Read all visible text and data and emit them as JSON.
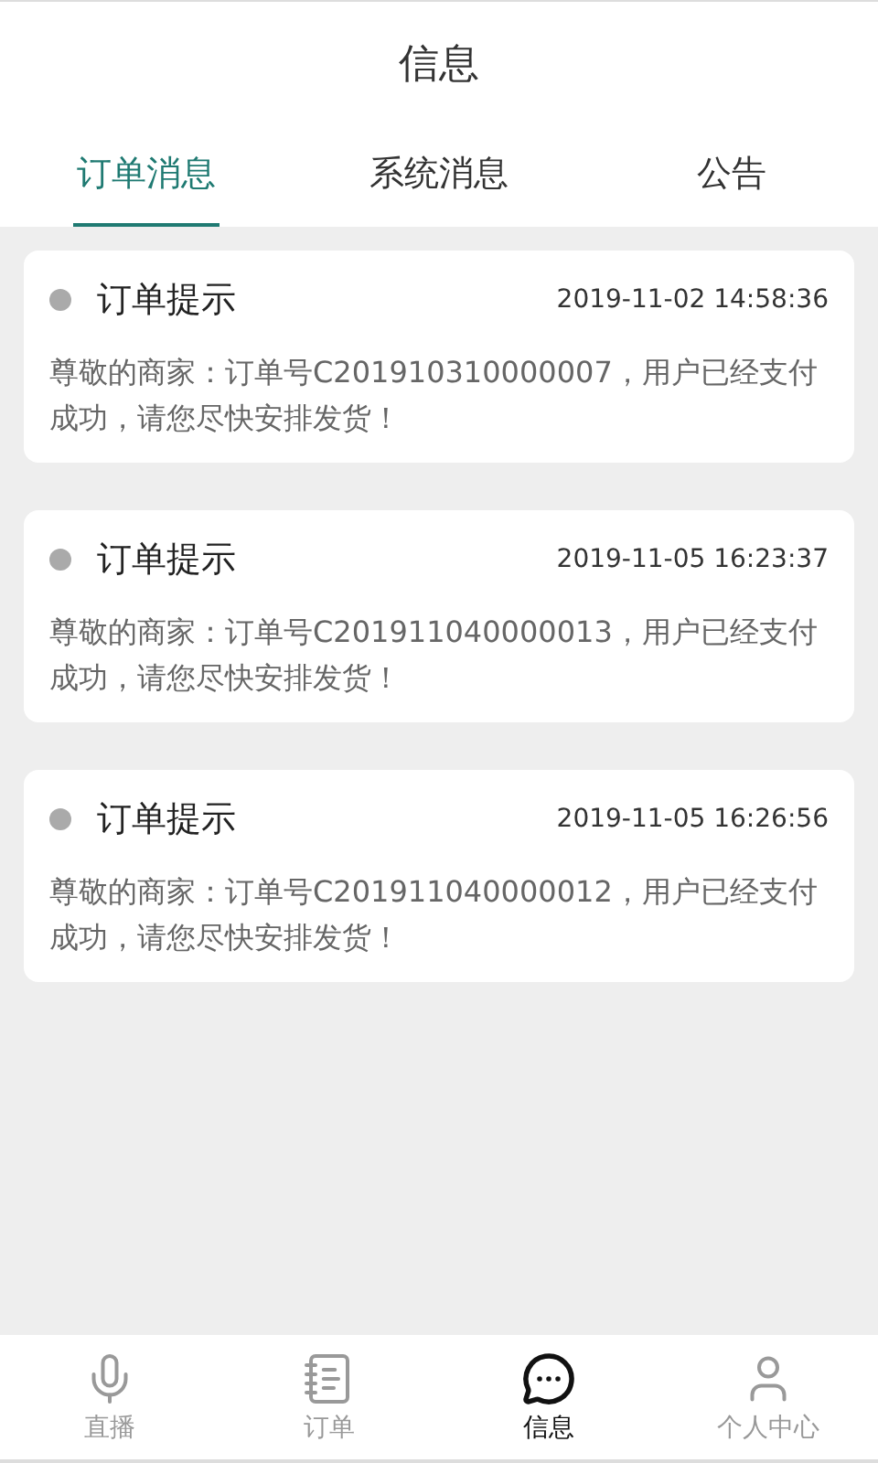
{
  "header": {
    "title": "信息"
  },
  "tabs": [
    {
      "label": "订单消息",
      "selected": true
    },
    {
      "label": "系统消息",
      "selected": false
    },
    {
      "label": "公告",
      "selected": false
    }
  ],
  "messages": [
    {
      "title": "订单提示",
      "time": "2019-11-02 14:58:36",
      "body": "尊敬的商家：订单号C201910310000007，用户已经支付成功，请您尽快安排发货！"
    },
    {
      "title": "订单提示",
      "time": "2019-11-05 16:23:37",
      "body": "尊敬的商家：订单号C201911040000013，用户已经支付成功，请您尽快安排发货！"
    },
    {
      "title": "订单提示",
      "time": "2019-11-05 16:26:56",
      "body": "尊敬的商家：订单号C201911040000012，用户已经支付成功，请您尽快安排发货！"
    }
  ],
  "bottom_nav": [
    {
      "kind": "mic",
      "label": "直播",
      "selected": false
    },
    {
      "kind": "notes",
      "label": "订单",
      "selected": false
    },
    {
      "kind": "chat",
      "label": "信息",
      "selected": true
    },
    {
      "kind": "person",
      "label": "个人中心",
      "selected": false
    }
  ]
}
